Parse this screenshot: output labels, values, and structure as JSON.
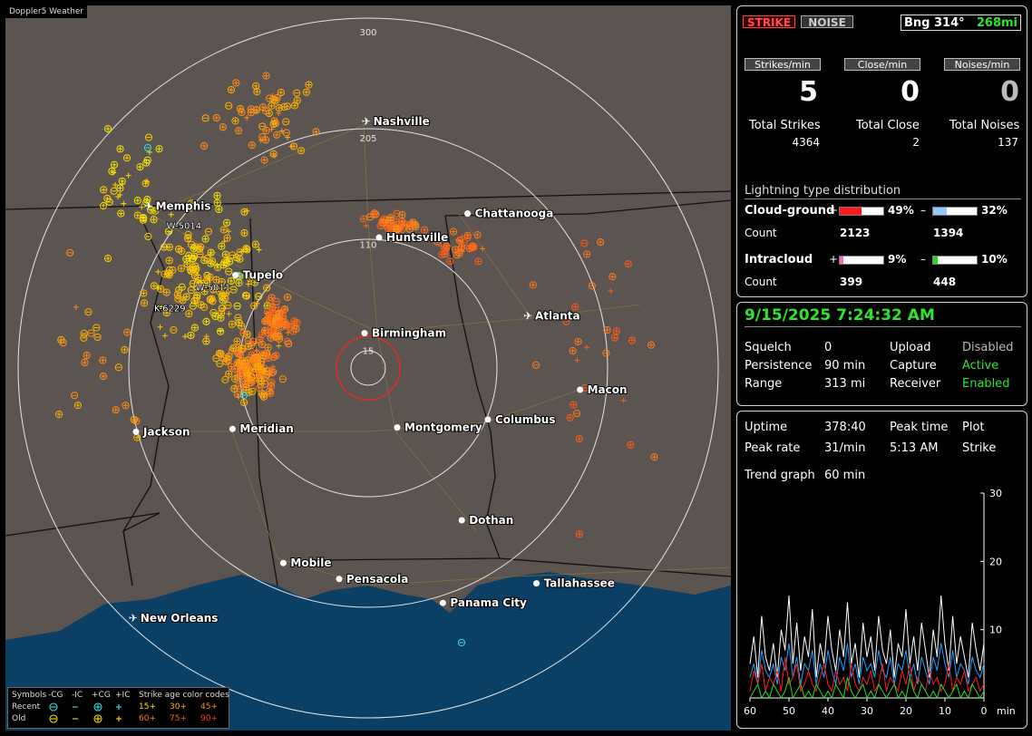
{
  "app": {
    "title": "Doppler5 Weather"
  },
  "header": {
    "strike_label": "STRIKE",
    "noise_label": "NOISE",
    "bearing": "Bng 314°",
    "bearing_range": "268mi"
  },
  "rates": {
    "strikes": {
      "label": "Strikes/min",
      "value": "5"
    },
    "close": {
      "label": "Close/min",
      "value": "0"
    },
    "noises": {
      "label": "Noises/min",
      "value": "0"
    }
  },
  "totals": {
    "strikes": {
      "label": "Total Strikes",
      "value": "4364"
    },
    "close": {
      "label": "Total Close",
      "value": "2"
    },
    "noises": {
      "label": "Total Noises",
      "value": "137"
    }
  },
  "distribution": {
    "title": "Lightning type distribution",
    "count_label": "Count",
    "cloud_ground": {
      "label": "Cloud-ground",
      "pos_sign": "+",
      "neg_sign": "–",
      "pos_pct": "49%",
      "neg_pct": "32%",
      "pos_fraction": 0.49,
      "neg_fraction": 0.32,
      "pos_count": "2123",
      "neg_count": "1394",
      "pos_color": "#ff1a1a",
      "neg_color": "#8fc8ff"
    },
    "intracloud": {
      "label": "Intracloud",
      "pos_sign": "+",
      "neg_sign": "–",
      "pos_pct": "9%",
      "neg_pct": "10%",
      "pos_fraction": 0.09,
      "neg_fraction": 0.1,
      "pos_count": "399",
      "neg_count": "448",
      "pos_color": "#ff66cc",
      "neg_color": "#22dd22"
    }
  },
  "status": {
    "datetime": "9/15/2025 7:24:32 AM",
    "squelch": {
      "label": "Squelch",
      "value": "0"
    },
    "persistence": {
      "label": "Persistence",
      "value": "90 min"
    },
    "range": {
      "label": "Range",
      "value": "313 mi"
    },
    "upload": {
      "label": "Upload",
      "value": "Disabled"
    },
    "capture": {
      "label": "Capture",
      "value": "Active"
    },
    "receiver": {
      "label": "Receiver",
      "value": "Enabled"
    }
  },
  "stats": {
    "uptime": {
      "label": "Uptime",
      "value": "378:40"
    },
    "peak_time": {
      "label": "Peak time",
      "value": "5:13 AM"
    },
    "peak_rate": {
      "label": "Peak rate",
      "value": "31/min"
    },
    "plot": {
      "label": "Plot",
      "value": "Strike"
    },
    "trend": {
      "label": "Trend graph",
      "value": "60 min"
    }
  },
  "chart_data": {
    "type": "line",
    "x": [
      60,
      59,
      58,
      57,
      56,
      55,
      54,
      53,
      52,
      51,
      50,
      49,
      48,
      47,
      46,
      45,
      44,
      43,
      42,
      41,
      40,
      39,
      38,
      37,
      36,
      35,
      34,
      33,
      32,
      31,
      30,
      29,
      28,
      27,
      26,
      25,
      24,
      23,
      22,
      21,
      20,
      19,
      18,
      17,
      16,
      15,
      14,
      13,
      12,
      11,
      10,
      9,
      8,
      7,
      6,
      5,
      4,
      3,
      2,
      1,
      0
    ],
    "xticks": [
      "60",
      "50",
      "40",
      "30",
      "20",
      "10",
      "0"
    ],
    "xtick_values": [
      60,
      50,
      40,
      30,
      20,
      10,
      0
    ],
    "xlabel": "min",
    "yticks": [
      "30",
      "20",
      "10"
    ],
    "ytick_values": [
      30,
      20,
      10
    ],
    "ylim": [
      0,
      30
    ],
    "xlim": [
      60,
      0
    ],
    "series": [
      {
        "color": "#ffffff",
        "values": [
          5,
          9,
          3,
          12,
          6,
          4,
          8,
          3,
          10,
          7,
          15,
          5,
          11,
          4,
          9,
          6,
          13,
          3,
          8,
          5,
          12,
          7,
          4,
          10,
          6,
          14,
          5,
          8,
          3,
          11,
          6,
          9,
          4,
          12,
          7,
          5,
          10,
          3,
          8,
          6,
          13,
          5,
          9,
          4,
          11,
          7,
          3,
          10,
          6,
          15,
          8,
          4,
          12,
          5,
          9,
          6,
          3,
          11,
          7,
          4,
          8
        ]
      },
      {
        "color": "#1f9fff",
        "values": [
          3,
          5,
          2,
          7,
          4,
          3,
          5,
          2,
          6,
          4,
          8,
          3,
          6,
          2,
          5,
          4,
          7,
          2,
          5,
          3,
          7,
          4,
          2,
          6,
          4,
          8,
          3,
          5,
          2,
          6,
          4,
          5,
          3,
          7,
          4,
          3,
          6,
          2,
          5,
          4,
          7,
          3,
          5,
          2,
          6,
          4,
          2,
          6,
          4,
          8,
          5,
          3,
          7,
          3,
          5,
          4,
          2,
          6,
          4,
          3,
          5
        ]
      },
      {
        "color": "#ff1a1a",
        "values": [
          1,
          4,
          2,
          5,
          1,
          3,
          2,
          4,
          1,
          6,
          2,
          3,
          5,
          1,
          2,
          4,
          2,
          1,
          3,
          5,
          2,
          1,
          4,
          2,
          3,
          1,
          5,
          2,
          1,
          3,
          2,
          4,
          1,
          2,
          5,
          1,
          3,
          2,
          1,
          4,
          2,
          5,
          1,
          3,
          2,
          1,
          4,
          2,
          3,
          1,
          2,
          5,
          1,
          3,
          2,
          4,
          1,
          2,
          3,
          1,
          2
        ]
      },
      {
        "color": "#22dd22",
        "values": [
          0,
          1,
          2,
          0,
          1,
          0,
          2,
          1,
          0,
          1,
          3,
          0,
          1,
          2,
          0,
          1,
          0,
          2,
          1,
          0,
          1,
          0,
          2,
          1,
          0,
          3,
          1,
          0,
          1,
          2,
          0,
          1,
          0,
          2,
          1,
          0,
          1,
          2,
          0,
          1,
          0,
          3,
          1,
          0,
          2,
          1,
          0,
          1,
          0,
          2,
          1,
          0,
          1,
          2,
          0,
          1,
          0,
          2,
          1,
          0,
          1
        ]
      }
    ]
  },
  "map": {
    "ring_labels": [
      {
        "label": "300",
        "range": 300
      },
      {
        "label": "205",
        "range": 205
      },
      {
        "label": "110",
        "range": 110
      },
      {
        "label": "15",
        "range": 15
      }
    ],
    "cities": [
      {
        "name": "Nashville",
        "airport": true,
        "fx": 0.497,
        "fy": 0.16
      },
      {
        "name": "Memphis",
        "airport": true,
        "fx": 0.197,
        "fy": 0.277
      },
      {
        "name": "Chattanooga",
        "airport": false,
        "fx": 0.637,
        "fy": 0.287
      },
      {
        "name": "Huntsville",
        "airport": false,
        "fx": 0.515,
        "fy": 0.32
      },
      {
        "name": "Tupelo",
        "airport": false,
        "fx": 0.317,
        "fy": 0.372
      },
      {
        "name": "Atlanta",
        "airport": true,
        "fx": 0.72,
        "fy": 0.428
      },
      {
        "name": "Birmingham",
        "airport": false,
        "fx": 0.495,
        "fy": 0.452
      },
      {
        "name": "Macon",
        "airport": false,
        "fx": 0.792,
        "fy": 0.53
      },
      {
        "name": "Jackson",
        "airport": false,
        "fx": 0.18,
        "fy": 0.588
      },
      {
        "name": "Meridian",
        "airport": false,
        "fx": 0.313,
        "fy": 0.584
      },
      {
        "name": "Montgomery",
        "airport": false,
        "fx": 0.54,
        "fy": 0.582
      },
      {
        "name": "Columbus",
        "airport": false,
        "fx": 0.665,
        "fy": 0.571
      },
      {
        "name": "Dothan",
        "airport": false,
        "fx": 0.629,
        "fy": 0.71
      },
      {
        "name": "Mobile",
        "airport": false,
        "fx": 0.383,
        "fy": 0.769
      },
      {
        "name": "Pensacola",
        "airport": false,
        "fx": 0.46,
        "fy": 0.791
      },
      {
        "name": "Tallahassee",
        "airport": false,
        "fx": 0.732,
        "fy": 0.797
      },
      {
        "name": "Panama City",
        "airport": false,
        "fx": 0.603,
        "fy": 0.824
      },
      {
        "name": "New Orleans",
        "airport": true,
        "fx": 0.176,
        "fy": 0.845
      }
    ],
    "storm_ids": [
      {
        "label": "W-5014",
        "fx": 0.222,
        "fy": 0.308
      },
      {
        "label": "W-5011",
        "fx": 0.262,
        "fy": 0.393
      },
      {
        "label": "K-6229",
        "fx": 0.205,
        "fy": 0.422
      }
    ]
  },
  "legend": {
    "symbols_label": "Symbols",
    "col_neg_cg": "-CG",
    "col_neg_ic": "-IC",
    "col_pos_cg": "+CG",
    "col_pos_ic": "+IC",
    "recent_label": "Recent",
    "old_label": "Old",
    "age_label": "Strike age color codes",
    "age_recent": [
      "15+",
      "30+",
      "45+"
    ],
    "age_old": [
      "60+",
      "75+",
      "90+"
    ]
  }
}
